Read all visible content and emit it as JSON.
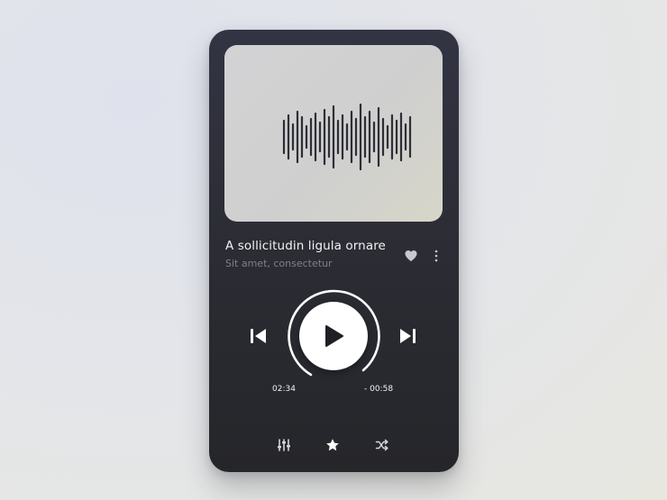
{
  "track": {
    "title": "A sollicitudin ligula ornare",
    "artist": "Sit amet, consectetur"
  },
  "playback": {
    "elapsed": "02:34",
    "remaining": "- 00:58",
    "is_playing": false
  },
  "icons": {
    "heart": "heart-icon",
    "more": "more-vertical-icon",
    "previous": "skip-previous-icon",
    "play": "play-icon",
    "next": "skip-next-icon",
    "equalizer": "equalizer-icon",
    "favorite": "star-icon",
    "shuffle": "shuffle-icon"
  },
  "colors": {
    "panel_top": "#333443",
    "panel_bottom": "#25262a",
    "artwork_bg": "#d1d1d1",
    "text_primary": "#f2f2f4",
    "text_secondary": "#7f8088",
    "accent": "#ffffff"
  }
}
